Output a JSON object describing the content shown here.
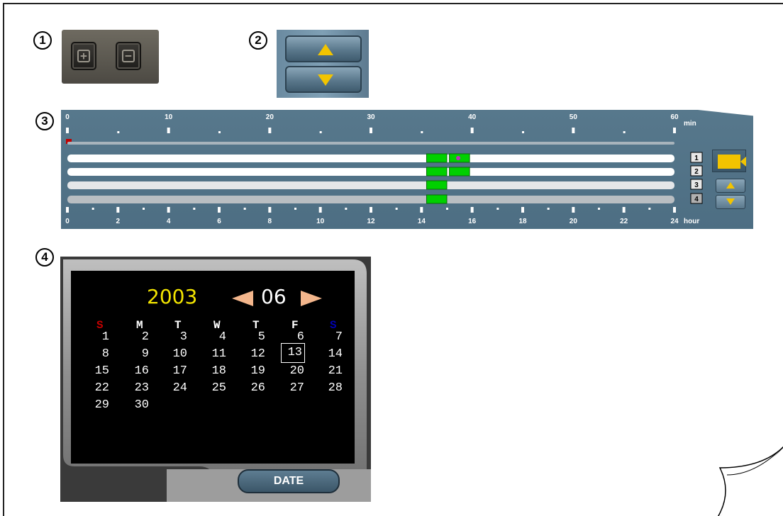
{
  "badges": [
    "1",
    "2",
    "3",
    "4"
  ],
  "zoom": {
    "plus_label": "+",
    "minus_label": "−"
  },
  "timeline": {
    "min_labels": [
      "0",
      "10",
      "20",
      "30",
      "40",
      "50",
      "60"
    ],
    "min_unit": "min",
    "hour_labels": [
      "0",
      "2",
      "4",
      "6",
      "8",
      "10",
      "12",
      "14",
      "16",
      "18",
      "20",
      "22",
      "24"
    ],
    "hour_unit": "hour",
    "channels": [
      "1",
      "2",
      "3",
      "4"
    ],
    "record_segments": [
      {
        "channel": 1,
        "start_hour": 14.2,
        "end_hour": 15.0,
        "color": "#00d000"
      },
      {
        "channel": 1,
        "start_hour": 15.1,
        "end_hour": 15.9,
        "color": "#00d000"
      },
      {
        "channel": 2,
        "start_hour": 14.2,
        "end_hour": 15.0,
        "color": "#00d000"
      },
      {
        "channel": 2,
        "start_hour": 15.1,
        "end_hour": 15.9,
        "color": "#00d000"
      },
      {
        "channel": 3,
        "start_hour": 14.2,
        "end_hour": 15.0,
        "color": "#00d000"
      },
      {
        "channel": 4,
        "start_hour": 14.2,
        "end_hour": 15.0,
        "color": "#00d000"
      }
    ]
  },
  "calendar": {
    "year": "2003",
    "month": "06",
    "weekdays": [
      "S",
      "M",
      "T",
      "W",
      "T",
      "F",
      "S"
    ],
    "weekday_colors": [
      "#c00000",
      "#ffffff",
      "#ffffff",
      "#ffffff",
      "#ffffff",
      "#ffffff",
      "#0000b0"
    ],
    "weeks": [
      [
        "1",
        "2",
        "3",
        "4",
        "5",
        "6",
        "7"
      ],
      [
        "8",
        "9",
        "10",
        "11",
        "12",
        "13",
        "14"
      ],
      [
        "15",
        "16",
        "17",
        "18",
        "19",
        "20",
        "21"
      ],
      [
        "22",
        "23",
        "24",
        "25",
        "26",
        "27",
        "28"
      ],
      [
        "29",
        "30",
        "",
        "",
        "",
        "",
        ""
      ]
    ],
    "selected_day": "13",
    "date_button": "DATE"
  }
}
